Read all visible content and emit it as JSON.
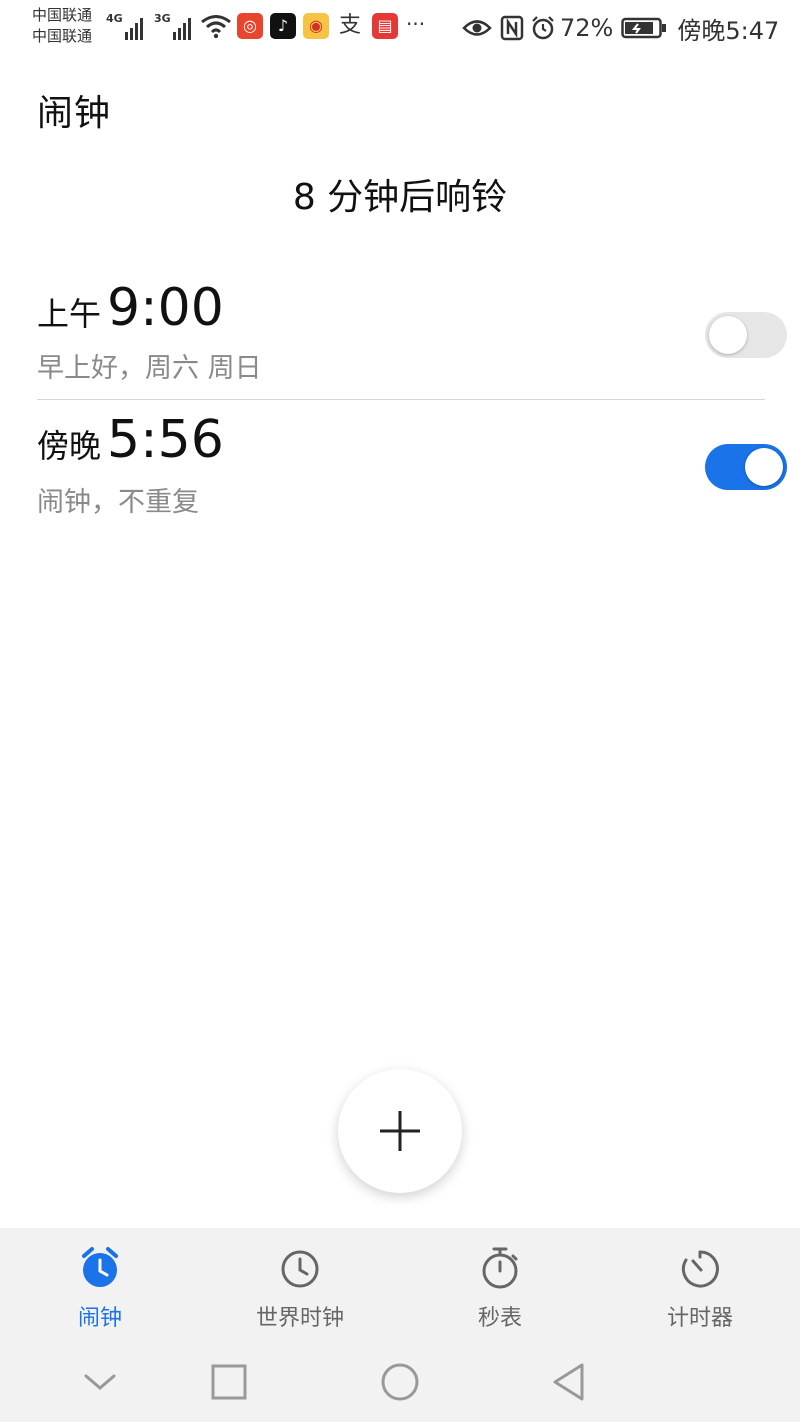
{
  "status_bar": {
    "carrier_1": "中国联通",
    "carrier_2": "中国联通",
    "signal_1_type": "4G",
    "signal_2_type": "3G",
    "app_icons": [
      "wifi-icon",
      "app-red-icon",
      "tiktok-icon",
      "weibo-icon",
      "alipay-icon",
      "reader-icon"
    ],
    "more": "···",
    "battery_percent": "72%",
    "time": "傍晚5:47"
  },
  "header": {
    "title": "闹钟",
    "next_ring": "8 分钟后响铃"
  },
  "alarms": [
    {
      "period": "上午",
      "time": "9:00",
      "subtitle": "早上好，周六 周日",
      "enabled": false
    },
    {
      "period": "傍晚",
      "time": "5:56",
      "subtitle": "闹钟，不重复",
      "enabled": true
    }
  ],
  "tabs": [
    {
      "label": "闹钟",
      "icon": "alarm-clock-icon",
      "active": true
    },
    {
      "label": "世界时钟",
      "icon": "world-clock-icon",
      "active": false
    },
    {
      "label": "秒表",
      "icon": "stopwatch-icon",
      "active": false
    },
    {
      "label": "计时器",
      "icon": "timer-icon",
      "active": false
    }
  ],
  "colors": {
    "accent": "#1a73e8",
    "toggle_off": "#e6e6e6",
    "subtitle": "#8a8a8a",
    "tab_bar_bg": "#f2f2f2"
  },
  "nav_bar": [
    "back-chevron-icon",
    "square-icon",
    "circle-home-icon",
    "triangle-back-icon"
  ]
}
